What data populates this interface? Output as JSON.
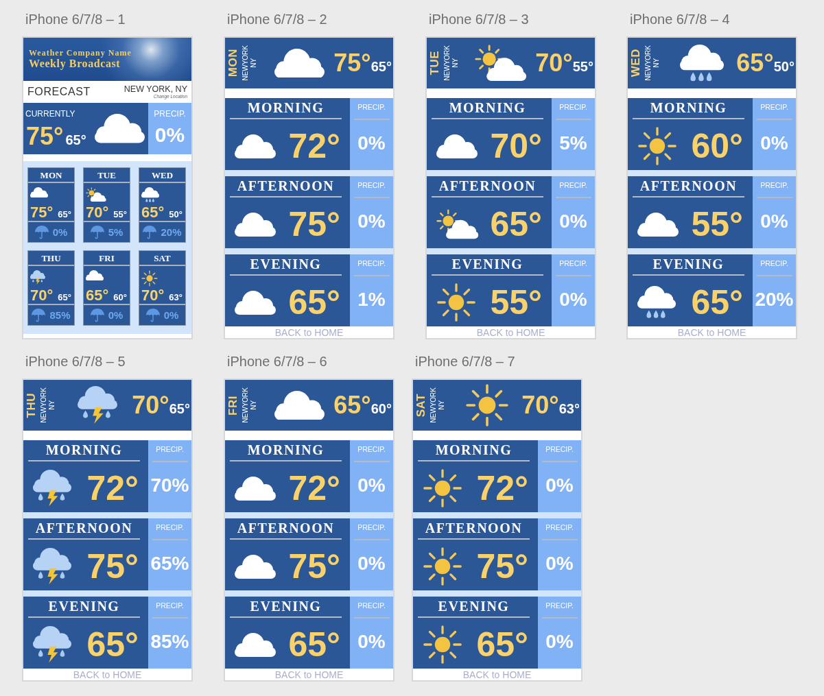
{
  "artboards": [
    {
      "title": "iPhone 6/7/8 – 1",
      "kind": "overview",
      "banner": {
        "company": "Weather Company Name",
        "subtitle": "Weekly Broadcast"
      },
      "heading": "FORECAST",
      "location": "NEW YORK, NY",
      "change_location": "Change Location",
      "current": {
        "label": "CURRENTLY",
        "high": "75°",
        "low": "65°",
        "kind": "cloudy",
        "precip_label": "PRECIP.",
        "precip": "0%"
      },
      "days": [
        {
          "day": "MON",
          "kind": "cloudy",
          "high": "75°",
          "low": "65°",
          "precip": "0%"
        },
        {
          "day": "TUE",
          "kind": "partlycloudy",
          "high": "70°",
          "low": "55°",
          "precip": "5%"
        },
        {
          "day": "WED",
          "kind": "rain",
          "high": "65°",
          "low": "50°",
          "precip": "20%"
        },
        {
          "day": "THU",
          "kind": "storm",
          "high": "70°",
          "low": "65°",
          "precip": "85%"
        },
        {
          "day": "FRI",
          "kind": "cloudy",
          "high": "65°",
          "low": "60°",
          "precip": "0%"
        },
        {
          "day": "SAT",
          "kind": "sunny",
          "high": "70°",
          "low": "63°",
          "precip": "0%"
        }
      ]
    },
    {
      "title": "iPhone 6/7/8 – 2",
      "kind": "day",
      "header": {
        "day": "MON",
        "city": "NEWYORK",
        "state": "NY",
        "kind": "cloudy",
        "high": "75°",
        "low": "65°"
      },
      "periods": [
        {
          "name": "MORNING",
          "kind": "cloudy",
          "temp": "72°",
          "precip_label": "PRECIP.",
          "precip": "0%"
        },
        {
          "name": "AFTERNOON",
          "kind": "cloudy",
          "temp": "75°",
          "precip_label": "PRECIP.",
          "precip": "0%"
        },
        {
          "name": "EVENING",
          "kind": "cloudy",
          "temp": "65°",
          "precip_label": "PRECIP.",
          "precip": "1%"
        }
      ],
      "back_link": "BACK to HOME"
    },
    {
      "title": "iPhone 6/7/8 – 3",
      "kind": "day",
      "header": {
        "day": "TUE",
        "city": "NEWYORK",
        "state": "NY",
        "kind": "partlycloudy",
        "high": "70°",
        "low": "55°"
      },
      "periods": [
        {
          "name": "MORNING",
          "kind": "cloudy",
          "temp": "70°",
          "precip_label": "PRECIP.",
          "precip": "5%"
        },
        {
          "name": "AFTERNOON",
          "kind": "partlycloudy",
          "temp": "65°",
          "precip_label": "PRECIP.",
          "precip": "0%"
        },
        {
          "name": "EVENING",
          "kind": "sunny",
          "temp": "55°",
          "precip_label": "PRECIP.",
          "precip": "0%"
        }
      ],
      "back_link": "BACK to HOME"
    },
    {
      "title": "iPhone 6/7/8 – 4",
      "kind": "day",
      "header": {
        "day": "WED",
        "city": "NEWYORK",
        "state": "NY",
        "kind": "rain",
        "high": "65°",
        "low": "50°"
      },
      "periods": [
        {
          "name": "MORNING",
          "kind": "sunny",
          "temp": "60°",
          "precip_label": "PRECIP.",
          "precip": "0%"
        },
        {
          "name": "AFTERNOON",
          "kind": "cloudy",
          "temp": "55°",
          "precip_label": "PRECIP.",
          "precip": "0%"
        },
        {
          "name": "EVENING",
          "kind": "rain",
          "temp": "65°",
          "precip_label": "PRECIP.",
          "precip": "20%"
        }
      ],
      "back_link": "BACK to HOME"
    },
    {
      "title": "iPhone 6/7/8 – 5",
      "kind": "day",
      "header": {
        "day": "THU",
        "city": "NEWYORK",
        "state": "NY",
        "kind": "storm",
        "high": "70°",
        "low": "65°"
      },
      "periods": [
        {
          "name": "MORNING",
          "kind": "storm",
          "temp": "72°",
          "precip_label": "PRECIP.",
          "precip": "70%"
        },
        {
          "name": "AFTERNOON",
          "kind": "storm",
          "temp": "75°",
          "precip_label": "PRECIP.",
          "precip": "65%"
        },
        {
          "name": "EVENING",
          "kind": "storm",
          "temp": "65°",
          "precip_label": "PRECIP.",
          "precip": "85%"
        }
      ],
      "back_link": "BACK to HOME"
    },
    {
      "title": "iPhone 6/7/8 – 6",
      "kind": "day",
      "header": {
        "day": "FRI",
        "city": "NEWYORK",
        "state": "NY",
        "kind": "cloudy",
        "high": "65°",
        "low": "60°"
      },
      "periods": [
        {
          "name": "MORNING",
          "kind": "cloudy",
          "temp": "72°",
          "precip_label": "PRECIP.",
          "precip": "0%"
        },
        {
          "name": "AFTERNOON",
          "kind": "cloudy",
          "temp": "75°",
          "precip_label": "PRECIP.",
          "precip": "0%"
        },
        {
          "name": "EVENING",
          "kind": "cloudy",
          "temp": "65°",
          "precip_label": "PRECIP.",
          "precip": "0%"
        }
      ],
      "back_link": "BACK to HOME"
    },
    {
      "title": "iPhone 6/7/8 – 7",
      "kind": "day",
      "header": {
        "day": "SAT",
        "city": "NEWYORK",
        "state": "NY",
        "kind": "sunny",
        "high": "70°",
        "low": "63°"
      },
      "periods": [
        {
          "name": "MORNING",
          "kind": "sunny",
          "temp": "72°",
          "precip_label": "PRECIP.",
          "precip": "0%"
        },
        {
          "name": "AFTERNOON",
          "kind": "sunny",
          "temp": "75°",
          "precip_label": "PRECIP.",
          "precip": "0%"
        },
        {
          "name": "EVENING",
          "kind": "sunny",
          "temp": "65°",
          "precip_label": "PRECIP.",
          "precip": "0%"
        }
      ],
      "back_link": "BACK to HOME"
    }
  ]
}
